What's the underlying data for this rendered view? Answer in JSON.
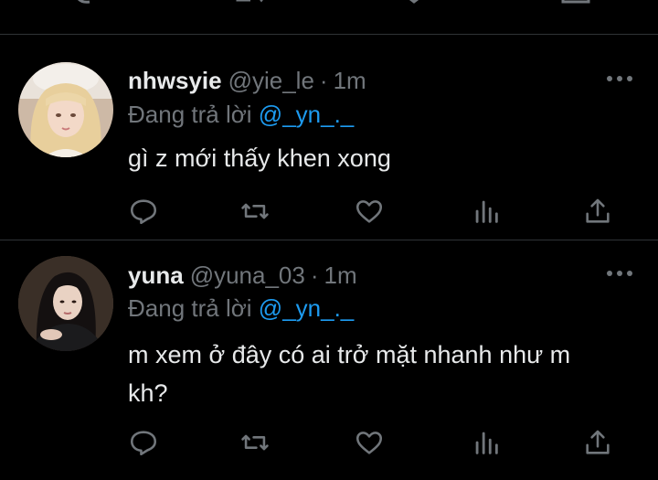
{
  "tweets": [
    {
      "display_name": "nhwsyie",
      "handle": "@yie_le",
      "separator": "·",
      "time": "1m",
      "reply_prefix": "Đang trả lời",
      "reply_to": "@_yn_._",
      "text": "gì z mới thấy khen xong"
    },
    {
      "display_name": "yuna",
      "handle": "@yuna_03",
      "separator": "·",
      "time": "1m",
      "reply_prefix": "Đang trả lời",
      "reply_to": "@_yn_._",
      "text": "m xem ở đây có ai trở mặt nhanh như m kh?"
    }
  ],
  "icons": {
    "reply": "reply-icon",
    "retweet": "retweet-icon",
    "like": "heart-icon",
    "views": "views-icon",
    "share": "share-icon",
    "more": "more-options-icon"
  },
  "colors": {
    "background": "#000000",
    "text_primary": "#e7e9ea",
    "text_secondary": "#71767b",
    "link": "#1d9bf0",
    "divider": "#2f3336"
  }
}
